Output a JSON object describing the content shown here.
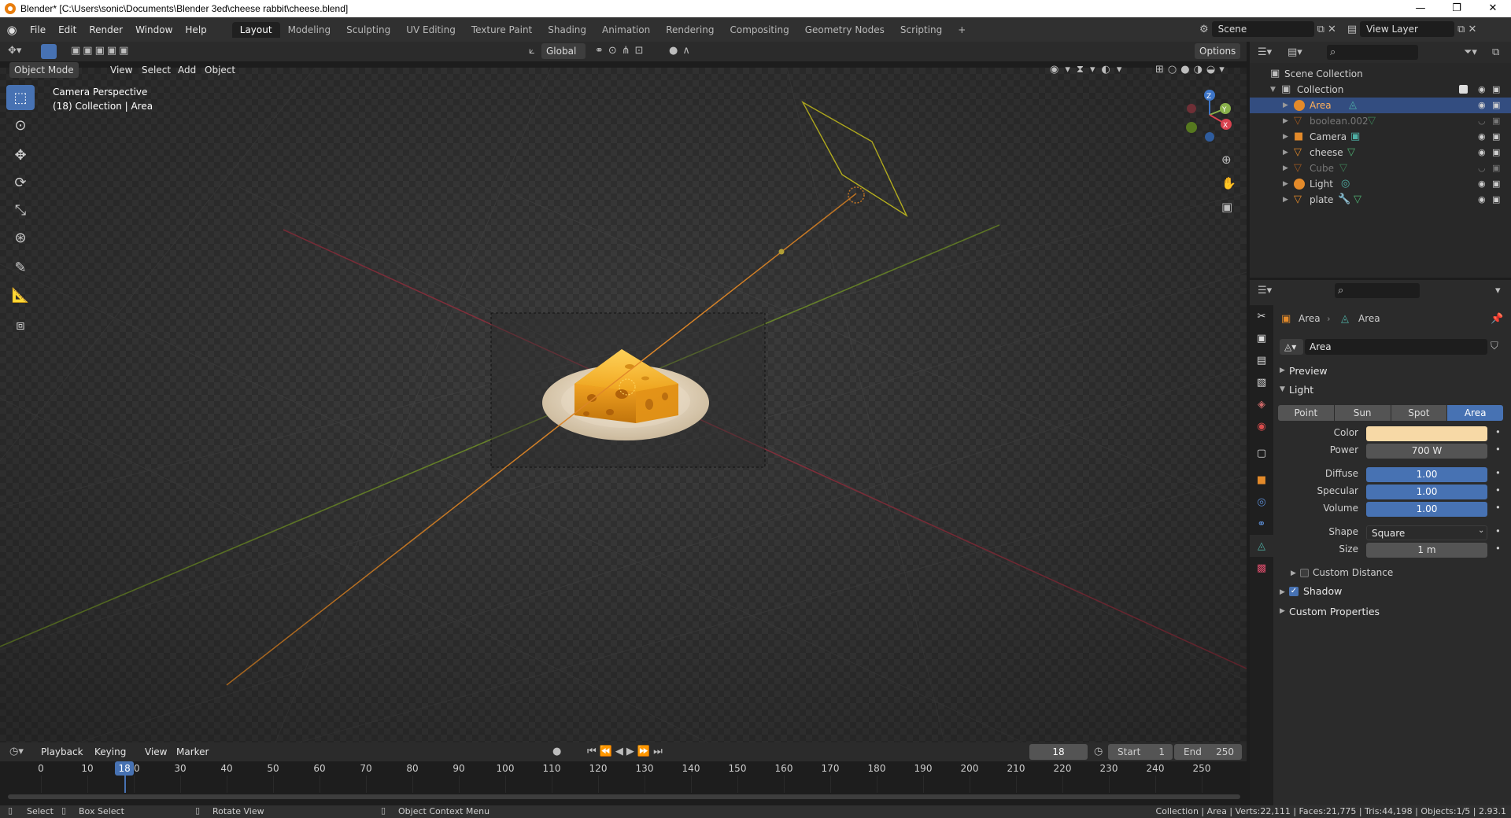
{
  "window": {
    "title": "Blender* [C:\\Users\\sonic\\Documents\\Blender 3ed\\cheese rabbit\\cheese.blend]",
    "controls": [
      "—",
      "❐",
      "✕"
    ]
  },
  "menu": [
    "File",
    "Edit",
    "Render",
    "Window",
    "Help"
  ],
  "workspaces": [
    {
      "label": "Layout",
      "active": true
    },
    {
      "label": "Modeling"
    },
    {
      "label": "Sculpting"
    },
    {
      "label": "UV Editing"
    },
    {
      "label": "Texture Paint"
    },
    {
      "label": "Shading"
    },
    {
      "label": "Animation"
    },
    {
      "label": "Rendering"
    },
    {
      "label": "Compositing"
    },
    {
      "label": "Geometry Nodes"
    },
    {
      "label": "Scripting"
    }
  ],
  "add_workspace": "+",
  "scene": {
    "name": "Scene",
    "view_layer": "View Layer"
  },
  "tool_header": {
    "orientation": "Global",
    "options": "Options"
  },
  "viewport_header": {
    "mode": "Object Mode",
    "menus": [
      "View",
      "Select",
      "Add",
      "Object"
    ]
  },
  "viewport": {
    "perspective": "Camera Perspective",
    "collection_info": "(18) Collection | Area",
    "gizmo": {
      "x": "X",
      "y": "Y",
      "z": "Z"
    }
  },
  "outliner": {
    "root": "Scene Collection",
    "collection": "Collection",
    "objects": [
      {
        "name": "Area",
        "type": "light",
        "selected": true,
        "visible": true
      },
      {
        "name": "boolean.002",
        "type": "mesh",
        "visible": false
      },
      {
        "name": "Camera",
        "type": "camera",
        "visible": true
      },
      {
        "name": "cheese",
        "type": "mesh",
        "visible": true
      },
      {
        "name": "Cube",
        "type": "mesh",
        "visible": false
      },
      {
        "name": "Light",
        "type": "light",
        "visible": true
      },
      {
        "name": "plate",
        "type": "mesh",
        "visible": true
      }
    ]
  },
  "properties": {
    "breadcrumb": [
      "Area",
      "Area"
    ],
    "datablock": "Area",
    "panels": {
      "preview": "Preview",
      "light": "Light",
      "custom_distance": "Custom Distance",
      "shadow": "Shadow",
      "custom_properties": "Custom Properties"
    },
    "light_types": [
      "Point",
      "Sun",
      "Spot",
      "Area"
    ],
    "active_light_type": "Area",
    "color_label": "Color",
    "color_value": "#f7d9a6",
    "power": {
      "label": "Power",
      "value": "700 W"
    },
    "diffuse": {
      "label": "Diffuse",
      "value": "1.00"
    },
    "specular": {
      "label": "Specular",
      "value": "1.00"
    },
    "volume": {
      "label": "Volume",
      "value": "1.00"
    },
    "shape": {
      "label": "Shape",
      "value": "Square"
    },
    "size": {
      "label": "Size",
      "value": "1 m"
    },
    "shadow_checked": true
  },
  "timeline": {
    "menus": [
      "Playback",
      "Keying",
      "View",
      "Marker"
    ],
    "current_frame": "18",
    "start_label": "Start",
    "start": "1",
    "end_label": "End",
    "end": "250",
    "ticks": [
      "0",
      "10",
      "20",
      "30",
      "40",
      "50",
      "60",
      "70",
      "80",
      "90",
      "100",
      "110",
      "120",
      "130",
      "140",
      "150",
      "160",
      "170",
      "180",
      "190",
      "200",
      "210",
      "220",
      "230",
      "240",
      "250"
    ],
    "playhead": "18"
  },
  "statusbar": {
    "hints": [
      "Select",
      "Box Select",
      "Rotate View",
      "Object Context Menu"
    ],
    "stats": "Collection | Area | Verts:22,111 | Faces:21,775 | Tris:44,198 | Objects:1/5 | 2.93.1"
  }
}
